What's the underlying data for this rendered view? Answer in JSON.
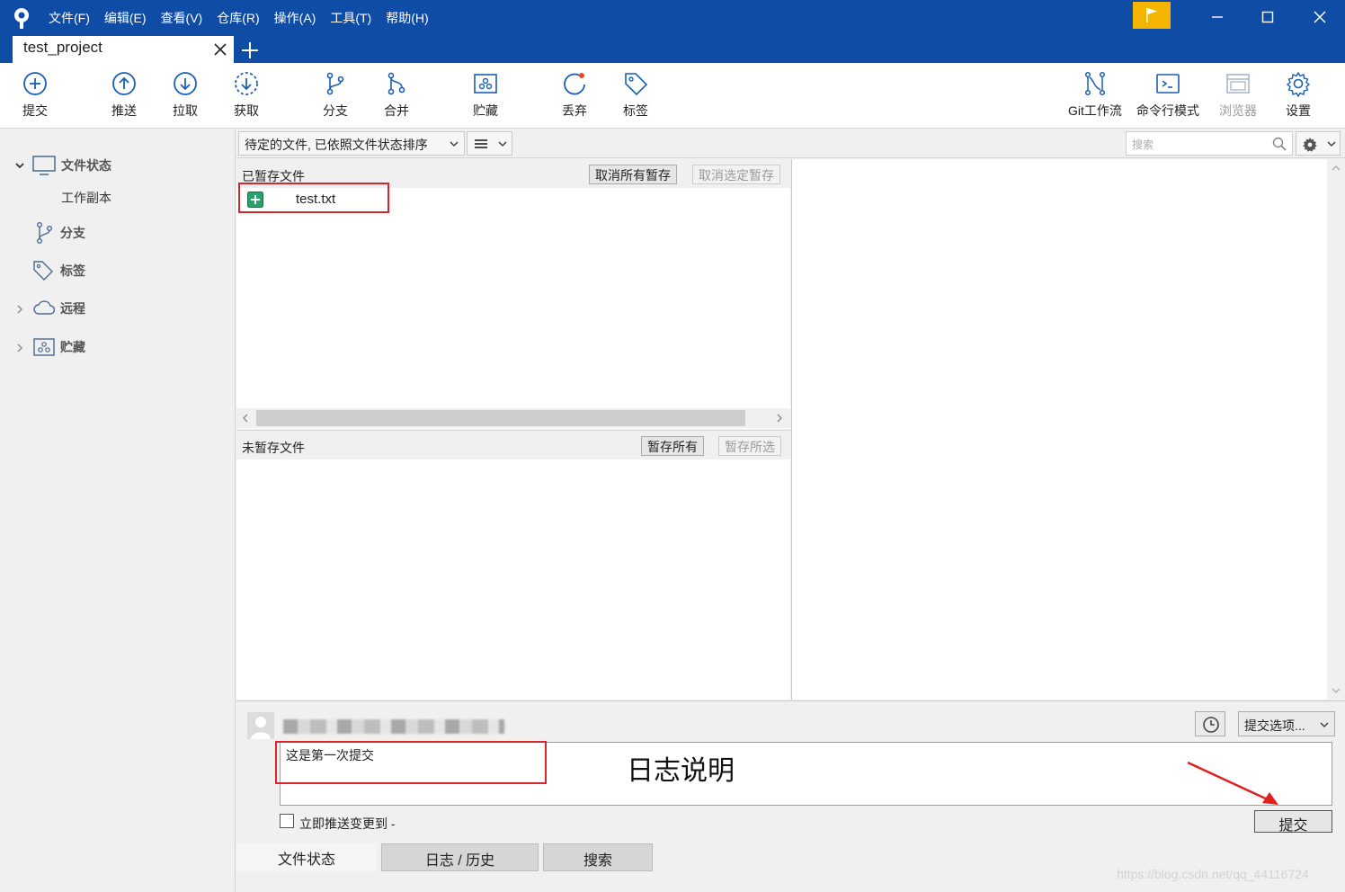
{
  "menu": [
    "文件(F)",
    "编辑(E)",
    "查看(V)",
    "仓库(R)",
    "操作(A)",
    "工具(T)",
    "帮助(H)"
  ],
  "tabs": {
    "active": "test_project"
  },
  "toolbar": {
    "commit": "提交",
    "push": "推送",
    "pull": "拉取",
    "fetch": "获取",
    "branch": "分支",
    "merge": "合并",
    "stash": "贮藏",
    "discard": "丢弃",
    "tag": "标签",
    "gitflow": "Git工作流",
    "terminal": "命令行模式",
    "browser": "浏览器",
    "settings": "设置"
  },
  "sidebar": {
    "file_status": "文件状态",
    "working_copy": "工作副本",
    "branches": "分支",
    "tags": "标签",
    "remotes": "远程",
    "stashes": "贮藏"
  },
  "filter": {
    "sort": "待定的文件, 已依照文件状态排序",
    "search_placeholder": "搜索"
  },
  "staged": {
    "title": "已暂存文件",
    "unstage_all": "取消所有暂存",
    "unstage_selected": "取消选定暂存",
    "files": [
      {
        "name": "test.txt",
        "status": "added"
      }
    ]
  },
  "unstaged": {
    "title": "未暂存文件",
    "stage_all": "暂存所有",
    "stage_selected": "暂存所选"
  },
  "commit": {
    "message": "这是第一次提交",
    "options": "提交选项...",
    "push_immediately": "立即推送变更到 -",
    "button": "提交",
    "annotation": "日志说明"
  },
  "bottom_tabs": {
    "file_status": "文件状态",
    "log": "日志 / 历史",
    "search": "搜索"
  },
  "watermark": "https://blog.csdn.net/qq_44116724",
  "colors": {
    "titlebar": "#0f4ca5",
    "accent": "#1a5fb4",
    "highlight": "#d9262c",
    "flag": "#f5b400"
  }
}
